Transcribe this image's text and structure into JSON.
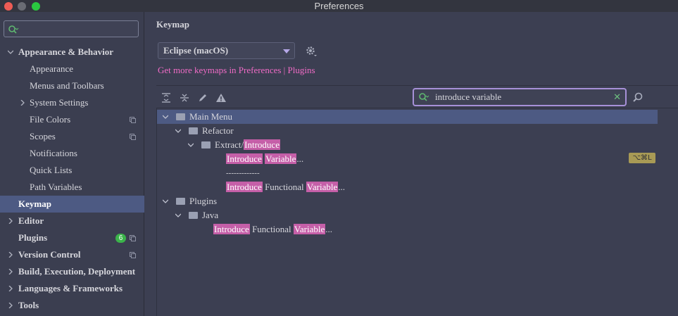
{
  "window": {
    "title": "Preferences"
  },
  "sidebar": {
    "search_value": "",
    "items": [
      {
        "label": "Appearance & Behavior",
        "level": 0,
        "expanded": true,
        "bold": true
      },
      {
        "label": "Appearance",
        "level": 1
      },
      {
        "label": "Menus and Toolbars",
        "level": 1
      },
      {
        "label": "System Settings",
        "level": 1,
        "collapsed": true
      },
      {
        "label": "File Colors",
        "level": 1,
        "copy_icon": true
      },
      {
        "label": "Scopes",
        "level": 1,
        "copy_icon": true
      },
      {
        "label": "Notifications",
        "level": 1
      },
      {
        "label": "Quick Lists",
        "level": 1
      },
      {
        "label": "Path Variables",
        "level": 1
      },
      {
        "label": "Keymap",
        "level": 0,
        "bold": true,
        "selected": true
      },
      {
        "label": "Editor",
        "level": 0,
        "bold": true,
        "collapsed": true
      },
      {
        "label": "Plugins",
        "level": 0,
        "bold": true,
        "badge": "6",
        "copy_icon": true
      },
      {
        "label": "Version Control",
        "level": 0,
        "bold": true,
        "collapsed": true,
        "copy_icon": true
      },
      {
        "label": "Build, Execution, Deployment",
        "level": 0,
        "bold": true,
        "collapsed": true
      },
      {
        "label": "Languages & Frameworks",
        "level": 0,
        "bold": true,
        "collapsed": true
      },
      {
        "label": "Tools",
        "level": 0,
        "bold": true,
        "collapsed": true
      }
    ]
  },
  "main": {
    "heading": "Keymap",
    "keymap_select": "Eclipse (macOS)",
    "more_link": "Get more keymaps in Preferences | Plugins",
    "search_value": "introduce variable",
    "tree": {
      "main_menu": "Main Menu",
      "refactor": "Refactor",
      "extract_prefix": "Extract/",
      "extract_hl": "Introduce",
      "item1_hl1": "Introduce",
      "item1_hl2": "Variable",
      "item1_suffix": "...",
      "shortcut": "⌥⌘L",
      "separator": "-------------",
      "item2_hl1": "Introduce",
      "item2_mid": "Functional",
      "item2_hl2": "Variable",
      "item2_suffix": "...",
      "plugins": "Plugins",
      "java": "Java",
      "item3_hl1": "Introduce",
      "item3_mid": "Functional",
      "item3_hl2": "Variable",
      "item3_suffix": "..."
    }
  },
  "colors": {
    "accent_link": "#f06bc6",
    "selection": "#4d5a83",
    "highlight": "#c55fa8"
  }
}
